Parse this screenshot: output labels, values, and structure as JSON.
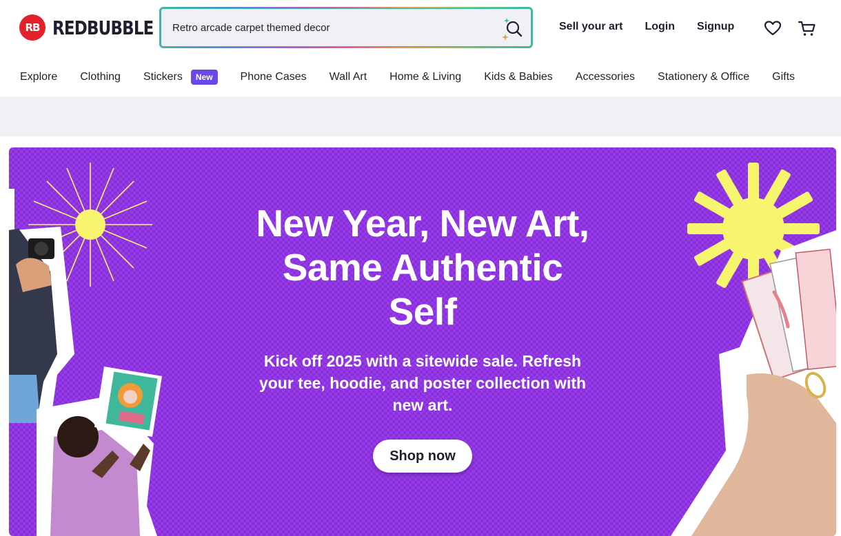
{
  "brand": {
    "logo_mark": "RB",
    "name": "REDBUBBLE",
    "color": "#e4202a"
  },
  "search": {
    "value": "Retro arcade carpet themed decor",
    "icon": "search-sparkle-icon"
  },
  "header_links": {
    "sell": "Sell your art",
    "login": "Login",
    "signup": "Signup"
  },
  "header_icons": {
    "wishlist": "heart-icon",
    "cart": "cart-icon"
  },
  "nav": {
    "items": [
      {
        "label": "Explore"
      },
      {
        "label": "Clothing"
      },
      {
        "label": "Stickers",
        "badge": "New"
      },
      {
        "label": "Phone Cases"
      },
      {
        "label": "Wall Art"
      },
      {
        "label": "Home & Living"
      },
      {
        "label": "Kids & Babies"
      },
      {
        "label": "Accessories"
      },
      {
        "label": "Stationery & Office"
      },
      {
        "label": "Gifts"
      }
    ]
  },
  "hero": {
    "title": "New Year, New Art, Same Authentic Self",
    "subtitle": "Kick off 2025 with a sitewide sale. Refresh your tee, hoodie, and poster collection with new art.",
    "cta": "Shop now",
    "background_color": "#8b2ee0",
    "accent_color": "#f7f56e"
  }
}
